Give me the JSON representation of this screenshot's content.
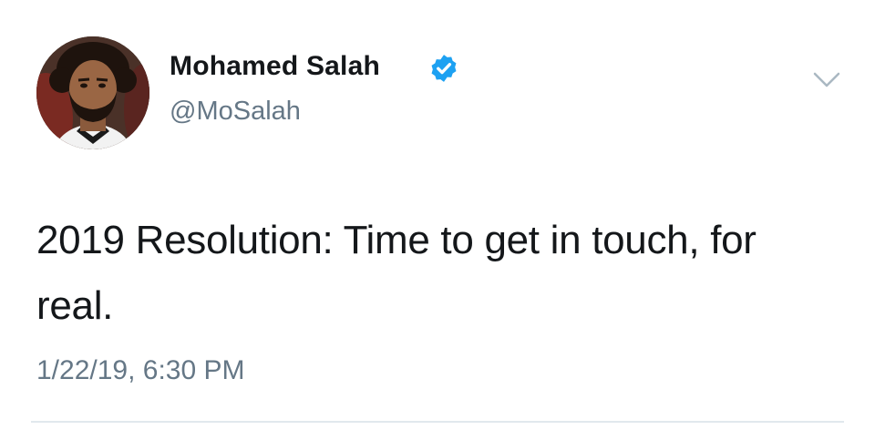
{
  "tweet": {
    "author": {
      "display_name": "Mohamed Salah",
      "handle": "@MoSalah",
      "verified": true,
      "avatar_icon": "profile-photo"
    },
    "text": "2019 Resolution: Time to get in touch, for real.",
    "timestamp": "1/22/19, 6:30 PM",
    "menu_icon": "chevron-down-icon"
  },
  "colors": {
    "text": "#14171a",
    "secondary_text": "#657786",
    "verified_badge": "#1da1f2",
    "divider": "#e1e8ed"
  }
}
